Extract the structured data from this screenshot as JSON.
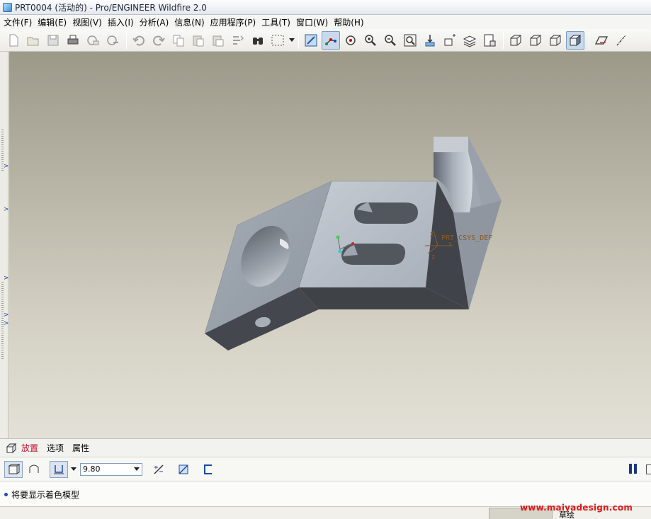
{
  "window": {
    "title": "PRT0004 (活动的) - Pro/ENGINEER Wildfire 2.0"
  },
  "menu": [
    "文件(F)",
    "编辑(E)",
    "视图(V)",
    "插入(I)",
    "分析(A)",
    "信息(N)",
    "应用程序(P)",
    "工具(T)",
    "窗口(W)",
    "帮助(H)"
  ],
  "toolbar": {
    "groups": [
      [
        "new-icon",
        "open-icon",
        "save-icon",
        "print-icon",
        "email-icon",
        "email-link-icon"
      ],
      [
        "undo-icon",
        "redo-icon",
        "copy-icon",
        "paste-icon",
        "paste-special-icon",
        "regenerate-icon",
        "find-icon",
        "select-box-icon"
      ],
      [
        "repaint-icon",
        "spin-center-icon",
        "orient-mode-icon",
        "zoom-in-icon",
        "zoom-out-icon",
        "refit-icon",
        "reorient-icon",
        "saved-views-icon",
        "layers-icon",
        "view-manager-icon"
      ],
      [
        "wireframe-icon",
        "hidden-line-icon",
        "no-hidden-icon",
        "shading-icon"
      ],
      [
        "datum-planes-icon",
        "datum-axes-icon"
      ]
    ],
    "active": [
      "spin-center-icon",
      "shading-icon"
    ]
  },
  "viewport": {
    "csys_label": "PRT_CSYS_DEF",
    "csys_axes": [
      "X",
      "Y",
      "Z"
    ],
    "colors": {
      "bg_top": "#9c9989",
      "bg_bottom": "#e3e1d7",
      "model_light": "#b2b9c2",
      "model_dark": "#3f4247"
    }
  },
  "dashboard": {
    "tabs": [
      "放置",
      "选项",
      "属性"
    ],
    "active_tab": "放置",
    "depth_value": "9.80"
  },
  "message": {
    "text": "将要显示着色模型"
  },
  "statusbar": {
    "filter_label": "草绘",
    "watermark": "www.maiyadesign.com"
  }
}
